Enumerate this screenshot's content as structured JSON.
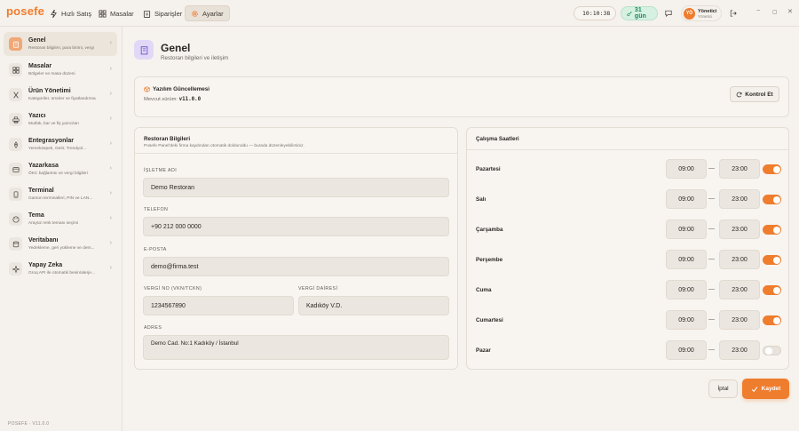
{
  "app": {
    "logo": "posefe"
  },
  "nav": {
    "tabs": [
      {
        "label": "Hızlı Satış",
        "icon": "bolt-icon"
      },
      {
        "label": "Masalar",
        "icon": "grid-icon"
      },
      {
        "label": "Siparişler",
        "icon": "clipboard-icon"
      },
      {
        "label": "Ayarlar",
        "icon": "gear-icon",
        "active": true
      }
    ],
    "clock": "10:10:38",
    "license_days": "31 gün",
    "user": {
      "initials": "YÖ",
      "name": "Yönetici",
      "role": "Yönetici"
    }
  },
  "sidebar": {
    "items": [
      {
        "title": "Genel",
        "subtitle": "Restoran bilgileri, para birimi, vergi",
        "icon": "building-icon",
        "active": true
      },
      {
        "title": "Masalar",
        "subtitle": "Bölgeler ve masa düzeni",
        "icon": "grid-icon"
      },
      {
        "title": "Ürün Yönetimi",
        "subtitle": "Kategoriler, ürünler ve fiyatlandırma",
        "icon": "utensils-icon"
      },
      {
        "title": "Yazıcı",
        "subtitle": "Mutfak, bar ve fiş yazıcıları",
        "icon": "printer-icon"
      },
      {
        "title": "Entegrasyonlar",
        "subtitle": "Yemeksepeti, Getir, Trendyol...",
        "icon": "plug-icon"
      },
      {
        "title": "Yazarkasa",
        "subtitle": "ÖKC bağlantısı ve vergi bilgileri",
        "icon": "register-icon"
      },
      {
        "title": "Terminal",
        "subtitle": "Garson terminalleri, PIN ve LAN...",
        "icon": "phone-icon"
      },
      {
        "title": "Tema",
        "subtitle": "Arayüz renk teması seçimi",
        "icon": "palette-icon"
      },
      {
        "title": "Veritabanı",
        "subtitle": "Yedekleme, geri yükleme ve dem...",
        "icon": "database-icon"
      },
      {
        "title": "Yapay Zeka",
        "subtitle": "Groq API ile otomatik besin/alerje...",
        "icon": "sparkle-icon"
      }
    ],
    "version": "POSEFE · V11.0.0"
  },
  "page": {
    "title": "Genel",
    "subtitle": "Restoran bilgileri ve iletişim"
  },
  "update": {
    "title": "Yazılım Güncellemesi",
    "current_label": "Mevcut sürüm:",
    "current_version": "v11.0.0",
    "check_label": "Kontrol Et"
  },
  "restaurant": {
    "title": "Restoran Bilgileri",
    "description": "Posefe Panel'deki firma kaydından otomatik dolduruldu — burada düzenleyebilirsiniz.",
    "business_name_label": "İŞLETME ADI",
    "business_name": "Demo Restoran",
    "phone_label": "TELEFON",
    "phone": "+90 212 000 0000",
    "email_label": "E-POSTA",
    "email": "demo@firma.test",
    "tax_no_label": "VERGİ NO (VKN/TCKN)",
    "tax_no": "1234567890",
    "tax_office_label": "VERGİ DAİRESİ",
    "tax_office": "Kadıköy V.D.",
    "address_label": "ADRES",
    "address": "Demo Cad. No:1 Kadıköy / İstanbul"
  },
  "hours": {
    "title": "Çalışma Saatleri",
    "days": [
      {
        "day": "Pazartesi",
        "open": "09:00",
        "close": "23:00",
        "enabled": true
      },
      {
        "day": "Salı",
        "open": "09:00",
        "close": "23:00",
        "enabled": true
      },
      {
        "day": "Çarşamba",
        "open": "09:00",
        "close": "23:00",
        "enabled": true
      },
      {
        "day": "Perşembe",
        "open": "09:00",
        "close": "23:00",
        "enabled": true
      },
      {
        "day": "Cuma",
        "open": "09:00",
        "close": "23:00",
        "enabled": true
      },
      {
        "day": "Cumartesi",
        "open": "09:00",
        "close": "23:00",
        "enabled": true
      },
      {
        "day": "Pazar",
        "open": "09:00",
        "close": "23:00",
        "enabled": false
      }
    ],
    "separator": "—"
  },
  "actions": {
    "cancel": "İptal",
    "save": "Kaydet"
  },
  "colors": {
    "accent": "#ef7d2e",
    "success": "#1f8a55",
    "background": "#f6f3ee"
  }
}
